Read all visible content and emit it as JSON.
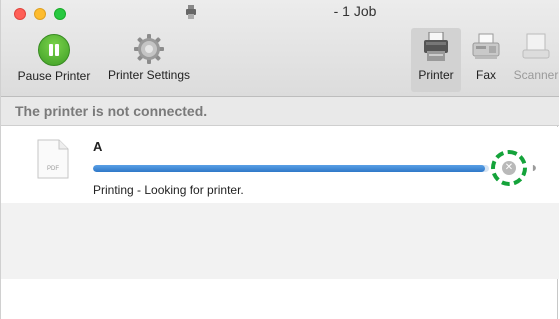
{
  "window": {
    "title": "- 1 Job"
  },
  "toolbar": {
    "pause_label": "Pause Printer",
    "settings_label": "Printer Settings",
    "segments": [
      {
        "label": "Printer",
        "icon": "printer-icon",
        "active": true
      },
      {
        "label": "Fax",
        "icon": "fax-icon",
        "active": false
      },
      {
        "label": "Scanner",
        "icon": "scanner-icon",
        "active": false,
        "disabled": true
      }
    ]
  },
  "status": {
    "message": "The printer is not connected."
  },
  "jobs": [
    {
      "name": "A",
      "file_type": "PDF",
      "status": "Printing - Looking for printer.",
      "progress": 0.99
    }
  ],
  "colors": {
    "pause_green": "#3e9e25",
    "progress_blue": "#2f78c8",
    "highlight_ring": "#14a33a"
  }
}
